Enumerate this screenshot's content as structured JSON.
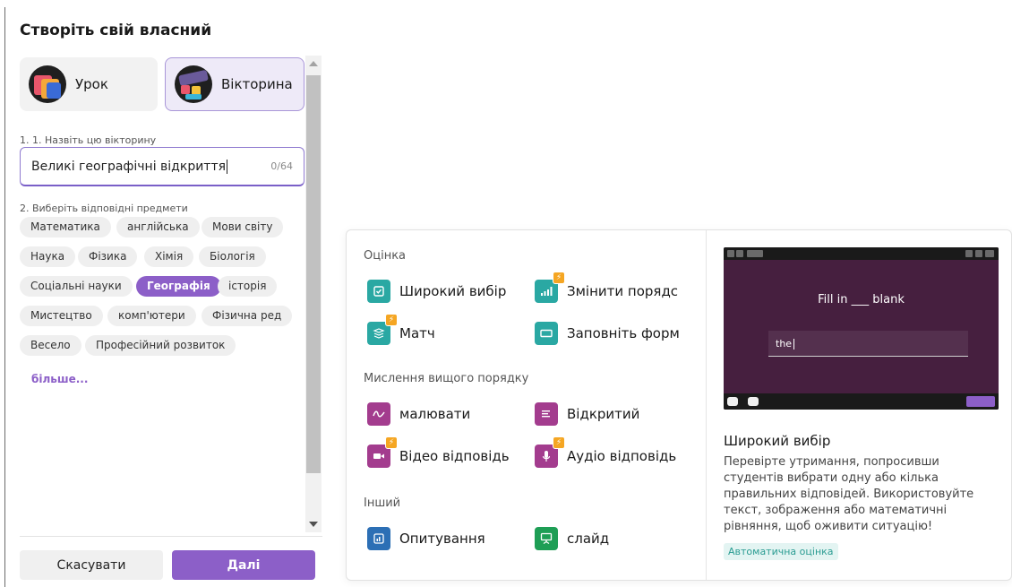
{
  "modal": {
    "title": "Створіть свій власний",
    "type_cards": [
      {
        "label": "Урок",
        "icon": "lesson-icon"
      },
      {
        "label": "Вікторина",
        "icon": "quiz-icon"
      }
    ],
    "name_field": {
      "label": "1. 1. Назвіть цю вікторину",
      "value": "Великі географічні відкриття",
      "counter": "0/64"
    },
    "subjects": {
      "label": "2. Виберіть відповідні предмети",
      "items": [
        {
          "label": "Математика",
          "active": false
        },
        {
          "label": "англійська",
          "active": false
        },
        {
          "label": "Мови світу",
          "active": false
        },
        {
          "label": "Наука",
          "active": false
        },
        {
          "label": "Фізика",
          "active": false
        },
        {
          "label": "Хімія",
          "active": false
        },
        {
          "label": "Біологія",
          "active": false
        },
        {
          "label": "Соціальні науки",
          "active": false
        },
        {
          "label": "Географія",
          "active": true
        },
        {
          "label": "історія",
          "active": false
        },
        {
          "label": "Мистецтво",
          "active": false
        },
        {
          "label": "комп'ютери",
          "active": false
        },
        {
          "label": "Фізична ред",
          "active": false
        },
        {
          "label": "Весело",
          "active": false
        },
        {
          "label": "Професійний розвиток",
          "active": false
        }
      ],
      "more_label": "більше..."
    },
    "buttons": {
      "cancel": "Скасувати",
      "next": "Далі"
    },
    "accent_color": "#8c5fc8"
  },
  "question_types": {
    "sections": [
      {
        "title": "Оцінка",
        "items": [
          {
            "label": "Широкий вибір",
            "icon": "checkbox-icon",
            "color": "#2aa8a3",
            "premium": false
          },
          {
            "label": "Змінити порядс",
            "icon": "bar-chart-icon",
            "color": "#2aa8a3",
            "premium": true
          },
          {
            "label": "Матч",
            "icon": "match-icon",
            "color": "#2aa8a3",
            "premium": true
          },
          {
            "label": "Заповніть форм",
            "icon": "blank-field-icon",
            "color": "#2aa8a3",
            "premium": false
          }
        ]
      },
      {
        "title": "Мислення вищого порядку",
        "items": [
          {
            "label": "малювати",
            "icon": "draw-icon",
            "color": "#a33c8e",
            "premium": false
          },
          {
            "label": "Відкритий",
            "icon": "text-lines-icon",
            "color": "#a33c8e",
            "premium": false
          },
          {
            "label": "Відео відповідь",
            "icon": "video-icon",
            "color": "#a33c8e",
            "premium": true
          },
          {
            "label": "Аудіо відповідь",
            "icon": "microphone-icon",
            "color": "#a33c8e",
            "premium": true
          }
        ]
      },
      {
        "title": "Інший",
        "items": [
          {
            "label": "Опитування",
            "icon": "poll-icon",
            "color": "#2c6fb5",
            "premium": false
          },
          {
            "label": "слайд",
            "icon": "presentation-icon",
            "color": "#1e9e55",
            "premium": false
          }
        ]
      }
    ],
    "preview": {
      "prompt": "Fill in ___ blank",
      "answer": "the",
      "title": "Широкий вибір",
      "description": "Перевірте утримання, попросивши студентів вибрати одну або кілька правильних відповідей. Використовуйте текст, зображення або математичні рівняння, щоб оживити ситуацію!",
      "badge": "Автоматична оцінка"
    }
  }
}
